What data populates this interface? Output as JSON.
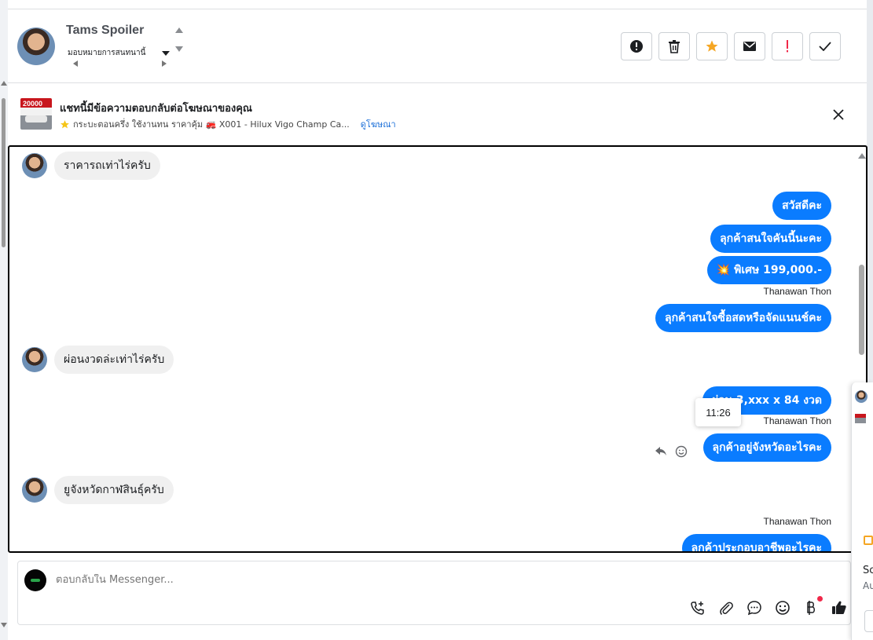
{
  "header": {
    "contact_name": "Tams Spoiler",
    "assign_label": "มอบหมายการสนทนานี้",
    "actions": [
      {
        "name": "spam-report-button",
        "icon": "alert-circle-icon"
      },
      {
        "name": "delete-button",
        "icon": "trash-icon"
      },
      {
        "name": "star-button",
        "icon": "star-icon"
      },
      {
        "name": "mark-unread-button",
        "icon": "envelope-icon"
      },
      {
        "name": "follow-up-button",
        "icon": "exclamation-icon"
      },
      {
        "name": "mark-done-button",
        "icon": "checkmark-icon"
      }
    ]
  },
  "ad": {
    "title": "แชทนี้มีข้อความตอบกลับต่อโฆษณาของคุณ",
    "thumb_text": "20000",
    "subtitle": "กระบะตอนครึ่ง ใช้งานทน ราคาคุ้ม 🚒 X001 - Hilux Vigo Champ Ca...",
    "link": "ดูโฆษณา"
  },
  "messages": {
    "in_1": "ราคารถเท่าไร่ครับ",
    "out_1": "สวัสดีคะ",
    "out_2": "ลุกค้าสนใจคันนี้นะคะ",
    "out_3": "💥 พิเศษ 199,000.-",
    "sender_1": "Thanawan Thon",
    "out_4": "ลุกค้าสนใจซื้อสดหรือจัดแนนช์คะ",
    "in_2": "ผ่อนงวดล่ะเท่าไร่ครับ",
    "out_5": "ผ่อน 3,xxx x 84 งวด",
    "tooltip_time": "11:26",
    "sender_2": "Thanawan Thon",
    "out_6": "ลุกค้าอยู่จังหวัดอะไรคะ",
    "in_3": "ยูจังหวัดกาฬสินธุ์ครับ",
    "sender_3": "Thanawan Thon",
    "out_7": "ลุกค้าประกอบอาชีพอะไรคะ"
  },
  "composer": {
    "placeholder": "ตอบกลับใน Messenger..."
  },
  "peek": {
    "line1": "Sc",
    "line2": "Au"
  },
  "colors": {
    "outgoing_bubble": "#0a7cff",
    "incoming_bubble": "#f0f0f0",
    "link": "#1a6ed8",
    "star": "#f5a623",
    "alert": "#f02849"
  }
}
